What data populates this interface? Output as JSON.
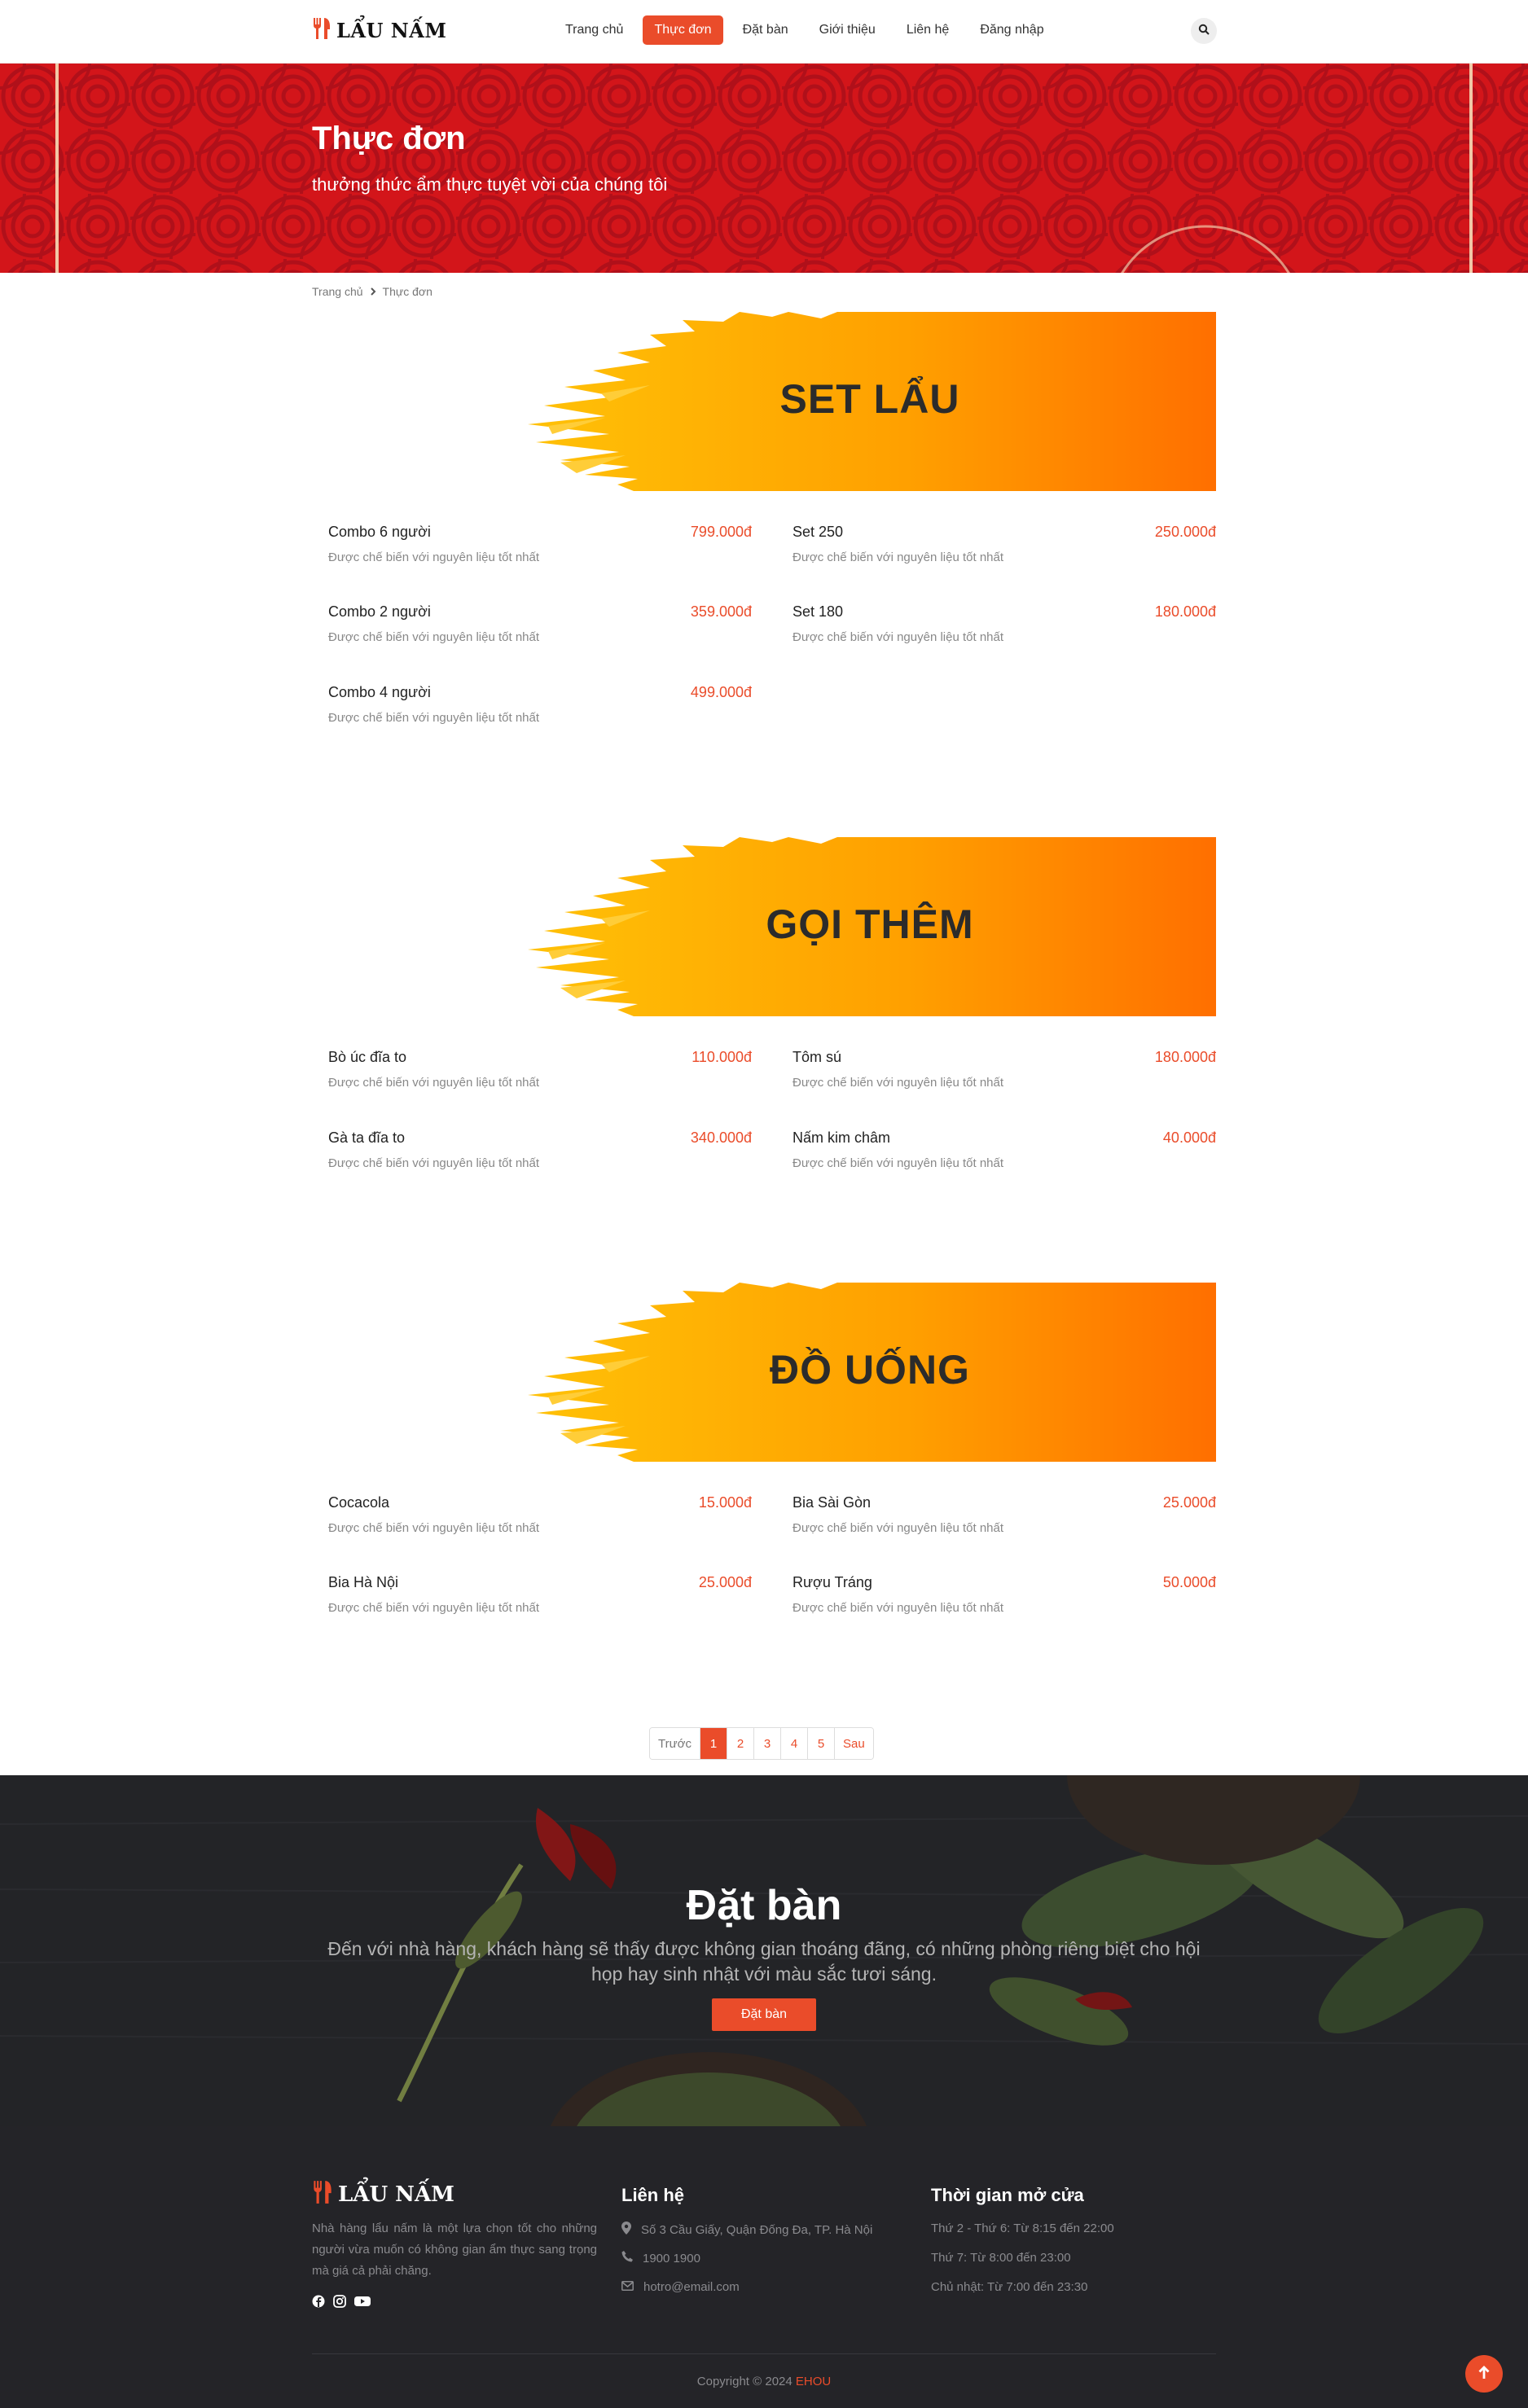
{
  "header": {
    "logo_text": "LẨU NẤM",
    "nav": [
      "Trang chủ",
      "Thực đơn",
      "Đặt bàn",
      "Giới thiệu",
      "Liên hệ",
      "Đăng nhập"
    ],
    "active_index": 1,
    "search_icon": "search-icon"
  },
  "hero": {
    "title": "Thực đơn",
    "subtitle": "thưởng thức ẩm thực tuyệt vời của chúng tôi"
  },
  "breadcrumb": {
    "home": "Trang chủ",
    "current": "Thực đơn"
  },
  "sections": [
    {
      "title": "SET LẨU",
      "items": [
        {
          "name": "Combo 6 người",
          "price": "799.000đ",
          "desc": "Được chế biến với nguyên liệu tốt nhất"
        },
        {
          "name": "Set 250",
          "price": "250.000đ",
          "desc": "Được chế biến với nguyên liệu tốt nhất"
        },
        {
          "name": "Combo 2 người",
          "price": "359.000đ",
          "desc": "Được chế biến với nguyên liệu tốt nhất"
        },
        {
          "name": "Set 180",
          "price": "180.000đ",
          "desc": "Được chế biến với nguyên liệu tốt nhất"
        },
        {
          "name": "Combo 4 người",
          "price": "499.000đ",
          "desc": "Được chế biến với nguyên liệu tốt nhất"
        }
      ]
    },
    {
      "title": "GỌI THÊM",
      "items": [
        {
          "name": "Bò úc đĩa to",
          "price": "110.000đ",
          "desc": "Được chế biến với nguyên liệu tốt nhất"
        },
        {
          "name": "Tôm sú",
          "price": "180.000đ",
          "desc": "Được chế biến với nguyên liệu tốt nhất"
        },
        {
          "name": "Gà ta đĩa to",
          "price": "340.000đ",
          "desc": "Được chế biến với nguyên liệu tốt nhất"
        },
        {
          "name": "Nấm kim châm",
          "price": "40.000đ",
          "desc": "Được chế biến với nguyên liệu tốt nhất"
        }
      ]
    },
    {
      "title": "ĐỒ UỐNG",
      "items": [
        {
          "name": "Cocacola",
          "price": "15.000đ",
          "desc": "Được chế biến với nguyên liệu tốt nhất"
        },
        {
          "name": "Bia Sài Gòn",
          "price": "25.000đ",
          "desc": "Được chế biến với nguyên liệu tốt nhất"
        },
        {
          "name": "Bia Hà Nội",
          "price": "25.000đ",
          "desc": "Được chế biến với nguyên liệu tốt nhất"
        },
        {
          "name": "Rượu Tráng",
          "price": "50.000đ",
          "desc": "Được chế biến với nguyên liệu tốt nhất"
        }
      ]
    }
  ],
  "pagination": {
    "prev": "Trước",
    "pages": [
      "1",
      "2",
      "3",
      "4",
      "5"
    ],
    "active": "1",
    "next": "Sau"
  },
  "booking": {
    "title": "Đặt bàn",
    "description": "Đến với nhà hàng, khách hàng sẽ thấy được không gian thoáng đãng, có những phòng riêng biệt cho hội họp hay sinh nhật với màu sắc tươi sáng.",
    "button": "Đặt bàn"
  },
  "footer": {
    "logo_text": "LẨU NẤM",
    "about": "Nhà hàng lẩu nấm là một lựa chọn tốt cho những người vừa muốn có không gian ẩm thực sang trọng mà giá cả phải chăng.",
    "social_icons": [
      "facebook-icon",
      "instagram-icon",
      "youtube-icon"
    ],
    "contact_title": "Liên hệ",
    "address": "Số 3 Cầu Giấy, Quận Đống Đa, TP. Hà Nội",
    "phone": "1900 1900",
    "email": "hotro@email.com",
    "hours_title": "Thời gian mở cửa",
    "hours": [
      "Thứ 2 - Thứ 6: Từ 8:15 đến 22:00",
      "Thứ 7: Từ 8:00 đến 23:00",
      "Chủ nhật: Từ 7:00 đến 23:30"
    ],
    "copyright": "Copyright © 2024",
    "brand": "EHOU"
  },
  "colors": {
    "accent": "#ea4c2a",
    "hero_red": "#d3151a",
    "banner_yellow": "#ffc107",
    "banner_orange": "#ff6f00",
    "footer_bg": "#242428"
  }
}
